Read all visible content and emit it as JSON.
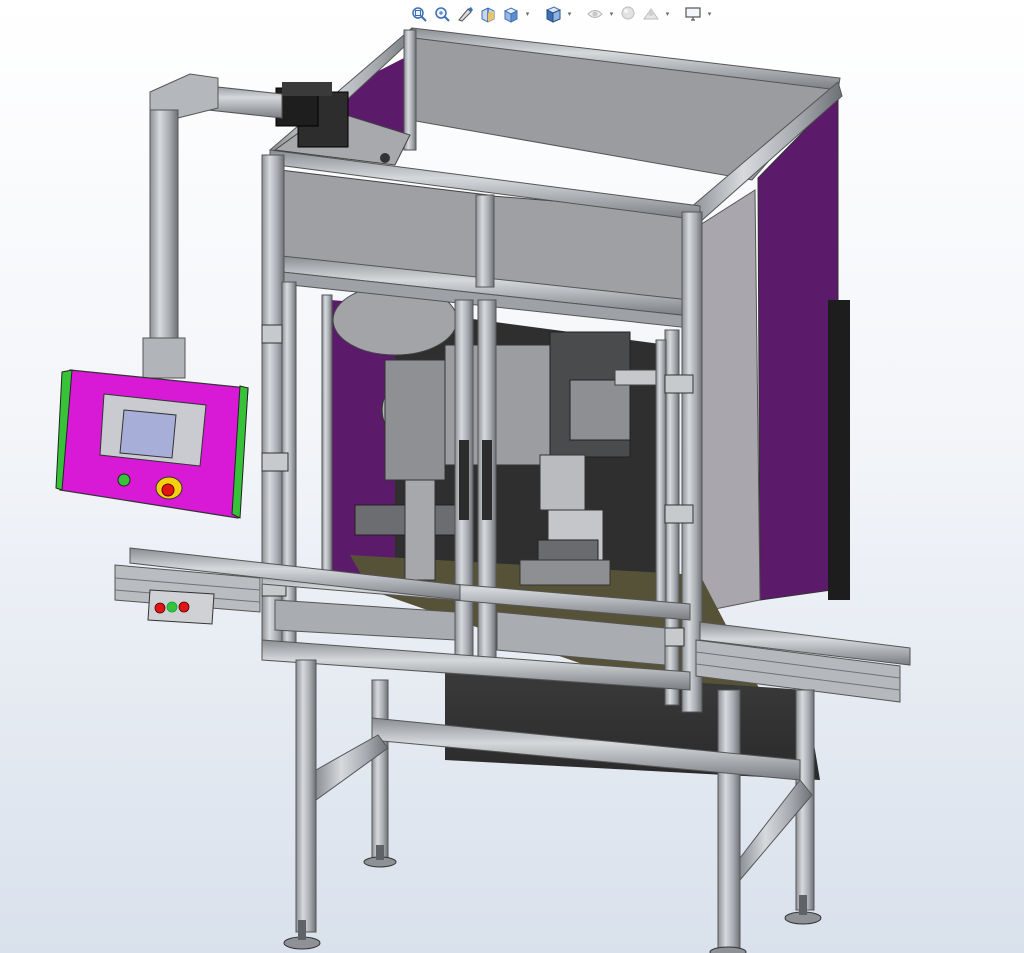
{
  "hud_toolbar": {
    "buttons": [
      {
        "id": "zoom-to-fit",
        "icon": "zoom-to-fit-icon",
        "has_dropdown": false
      },
      {
        "id": "zoom-to-area",
        "icon": "zoom-to-area-icon",
        "has_dropdown": false
      },
      {
        "id": "previous-view",
        "icon": "previous-view-icon",
        "has_dropdown": false
      },
      {
        "id": "section-view",
        "icon": "section-view-icon",
        "has_dropdown": false
      },
      {
        "id": "dynamic-annotation-views",
        "icon": "view-orientation-icon",
        "has_dropdown": true
      },
      {
        "id": "display-style",
        "icon": "display-style-icon",
        "has_dropdown": true
      },
      {
        "id": "hide-show-items",
        "icon": "hide-show-items-icon",
        "has_dropdown": true,
        "disabled": true
      },
      {
        "id": "edit-appearance",
        "icon": "edit-appearance-icon",
        "has_dropdown": true,
        "disabled": true
      },
      {
        "id": "view-settings",
        "icon": "view-settings-icon",
        "has_dropdown": true
      }
    ],
    "dropdown_glyph": "▾"
  },
  "model": {
    "kind": "3D CAD assembly",
    "colors": {
      "frame": "#b9bcc0",
      "frame_dark": "#7d8186",
      "panel_purple": "#5c1a6b",
      "panel_gray": "#9a9b9e",
      "hmi_magenta": "#d819d6",
      "hmi_green": "#38c23a",
      "screen": "#a7aed8",
      "estop_red": "#e01515",
      "estop_yellow": "#f5d10d",
      "base_plate": "#565237"
    }
  }
}
